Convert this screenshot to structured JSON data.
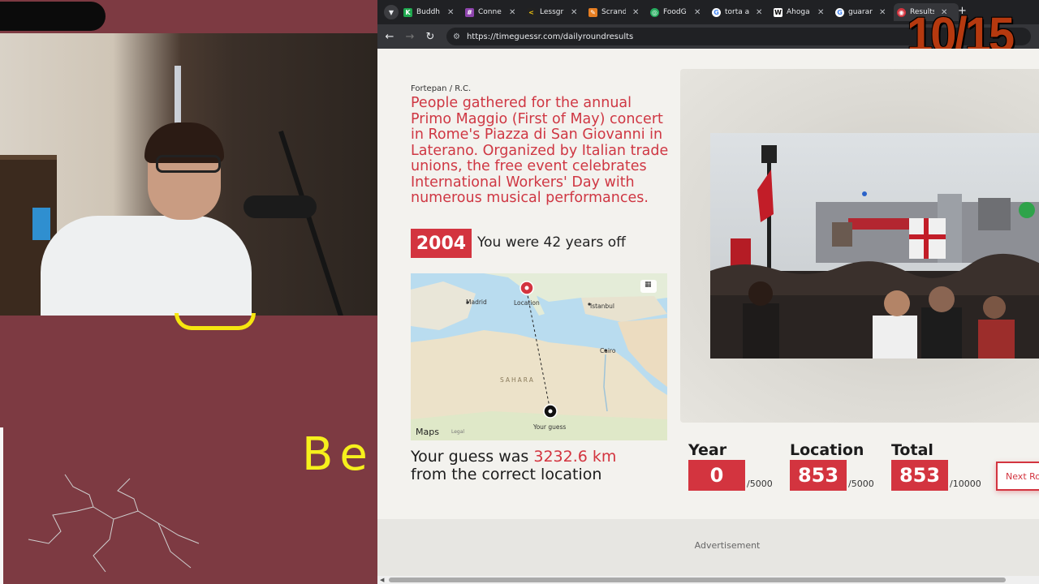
{
  "stream": {
    "handwriting": "Be"
  },
  "browser": {
    "tabs": [
      {
        "label": "Buddh",
        "icon": "k-icon",
        "color": "#1fa84f"
      },
      {
        "label": "Conne",
        "icon": "grid-icon",
        "color": "#8e44ad"
      },
      {
        "label": "Lessgr",
        "icon": "chevron-icon",
        "color": "#f1c40f"
      },
      {
        "label": "Scrand",
        "icon": "scramble-icon",
        "color": "#e67e22"
      },
      {
        "label": "FoodG",
        "icon": "globe-icon",
        "color": "#27ae60"
      },
      {
        "label": "torta a",
        "icon": "google-icon",
        "color": "#4285f4"
      },
      {
        "label": "Ahoga",
        "icon": "wikipedia-icon",
        "color": "#ffffff"
      },
      {
        "label": "guarar",
        "icon": "google-icon",
        "color": "#4285f4"
      },
      {
        "label": "Results",
        "icon": "timeguessr-icon",
        "color": "#d3343f"
      }
    ],
    "url": "https://timeguessr.com/dailyroundresults",
    "round_counter": "10/15"
  },
  "result": {
    "credit": "Fortepan / R.C.",
    "description": "People gathered for the annual Primo Maggio (First of May) concert in Rome's Piazza di San Giovanni in Laterano. Organized by Italian trade unions, the free event celebrates International Workers' Day with numerous musical performances.",
    "year": "2004",
    "years_off_text": "You were 42 years off",
    "map": {
      "labels": {
        "madrid": "Madrid",
        "location": "Location",
        "istanbul": "Istanbul",
        "cairo": "Cairo",
        "sahara": "SAHARA",
        "your_guess": "Your guess",
        "maps": "Maps",
        "legal": "Legal"
      }
    },
    "guess_prefix": "Your guess was ",
    "guess_distance": "3232.6 km",
    "guess_suffix": "from the correct location",
    "scores": {
      "year_label": "Year",
      "year_value": "0",
      "year_max": "/5000",
      "location_label": "Location",
      "location_value": "853",
      "location_max": "/5000",
      "total_label": "Total",
      "total_value": "853",
      "total_max": "/10000"
    },
    "next_round_label": "Next Ro",
    "advertisement": "Advertisement"
  }
}
